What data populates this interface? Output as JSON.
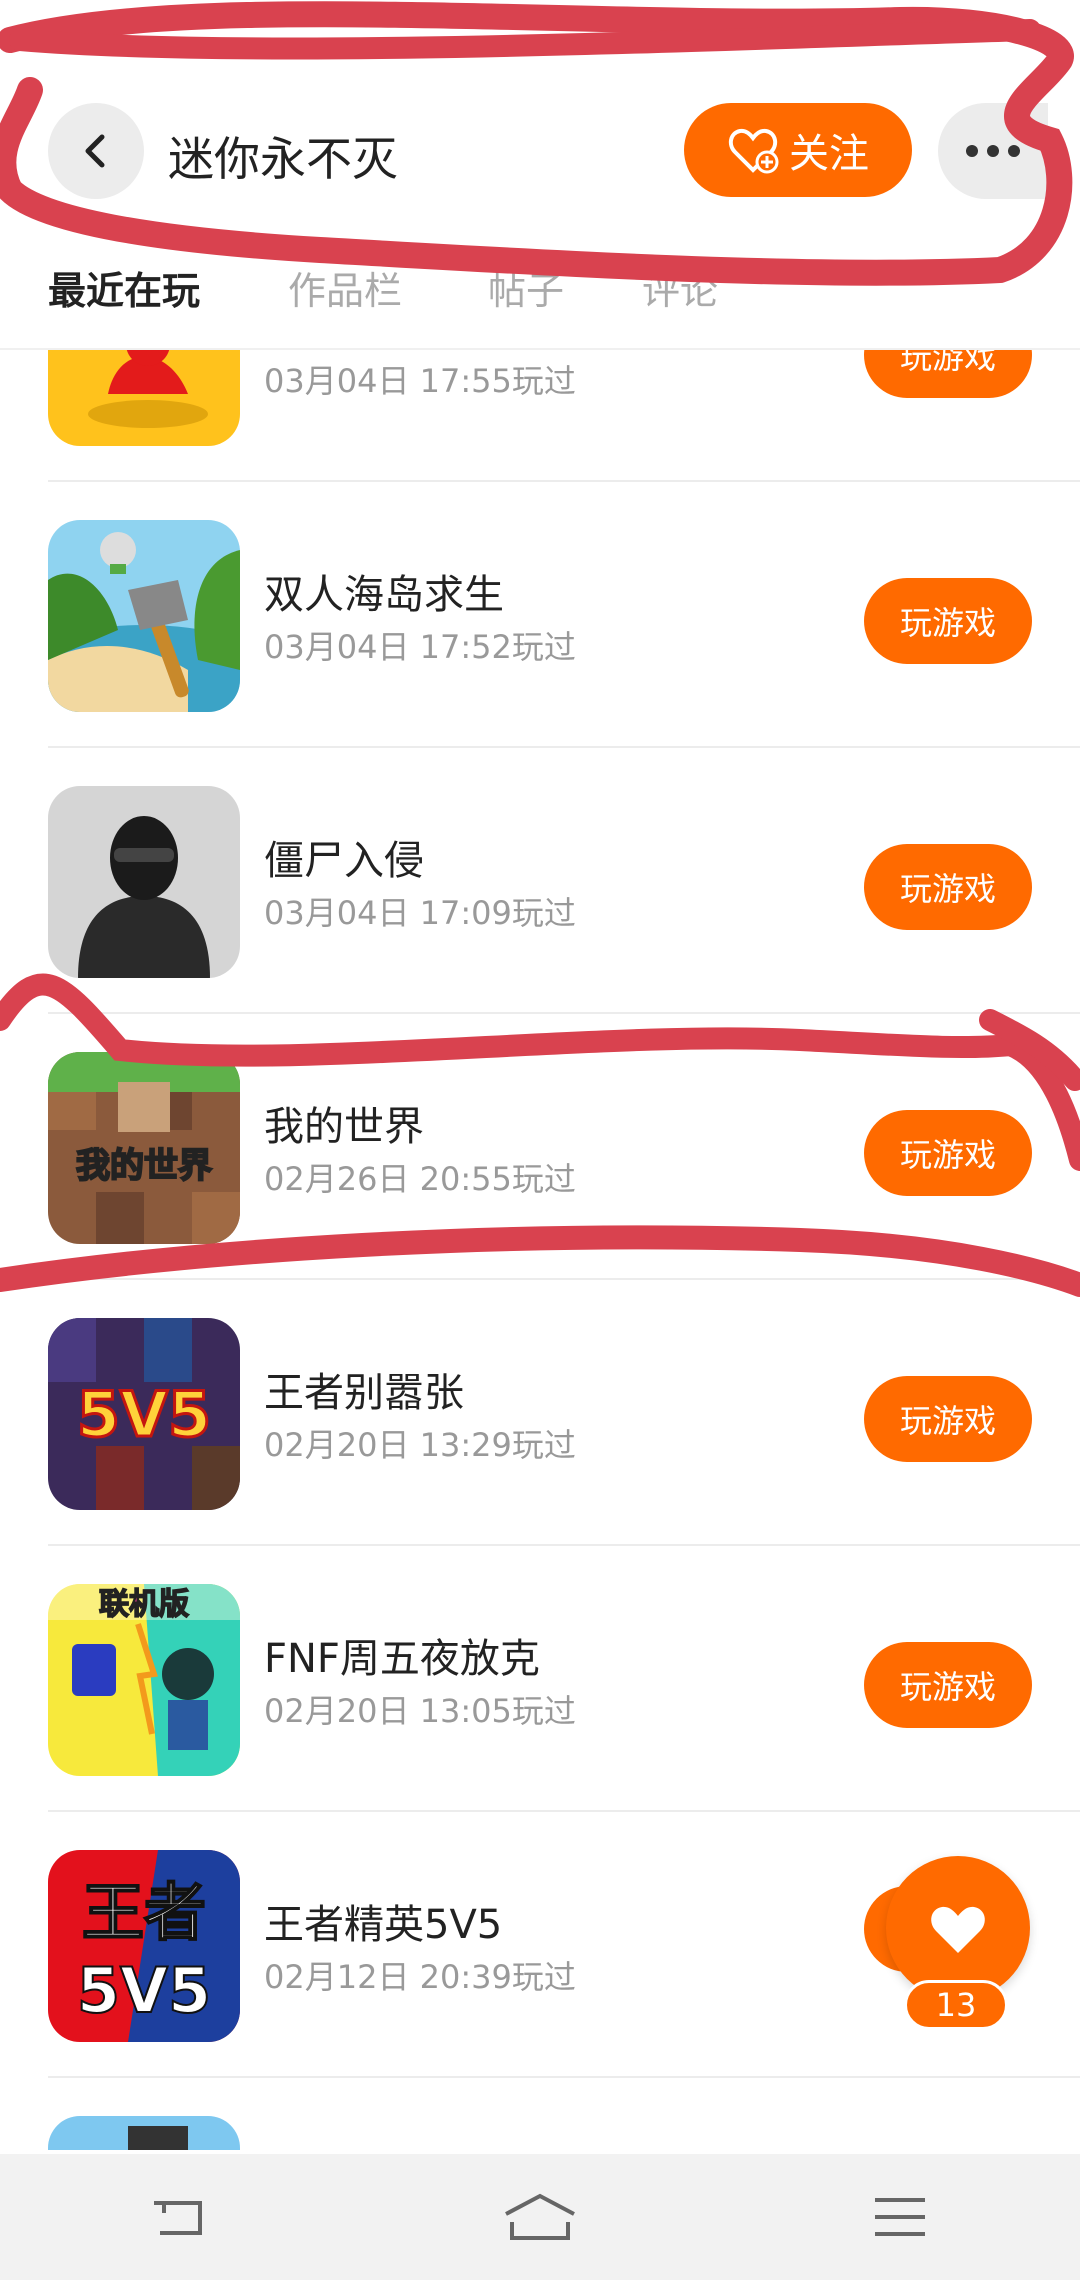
{
  "header": {
    "title": "迷你永不灭",
    "follow_label": "关注"
  },
  "tabs": [
    {
      "label": "最近在玩",
      "active": true
    },
    {
      "label": "作品栏",
      "active": false
    },
    {
      "label": "帖子",
      "active": false
    },
    {
      "label": "评论",
      "active": false
    }
  ],
  "games": [
    {
      "name": "",
      "time": "03月04日 17:55玩过",
      "button": "玩游戏"
    },
    {
      "name": "双人海岛求生",
      "time": "03月04日 17:52玩过",
      "button": "玩游戏"
    },
    {
      "name": "僵尸入侵",
      "time": "03月04日 17:09玩过",
      "button": "玩游戏"
    },
    {
      "name": "我的世界",
      "time": "02月26日 20:55玩过",
      "button": "玩游戏"
    },
    {
      "name": "王者别嚣张",
      "time": "02月20日 13:29玩过",
      "button": "玩游戏"
    },
    {
      "name": "FNF周五夜放克",
      "time": "02月20日 13:05玩过",
      "button": "玩游戏"
    },
    {
      "name": "王者精英5V5",
      "time": "02月12日 20:39玩过",
      "button": ""
    }
  ],
  "icon_texts": {
    "minecraft": "我的世界",
    "wz1": "5V5",
    "fnf": "联机版",
    "wz2_top": "王者",
    "wz2_bottom": "5V5"
  },
  "like": {
    "count": "13"
  },
  "colors": {
    "accent": "#ff6a00",
    "annotation": "#d9424f"
  }
}
